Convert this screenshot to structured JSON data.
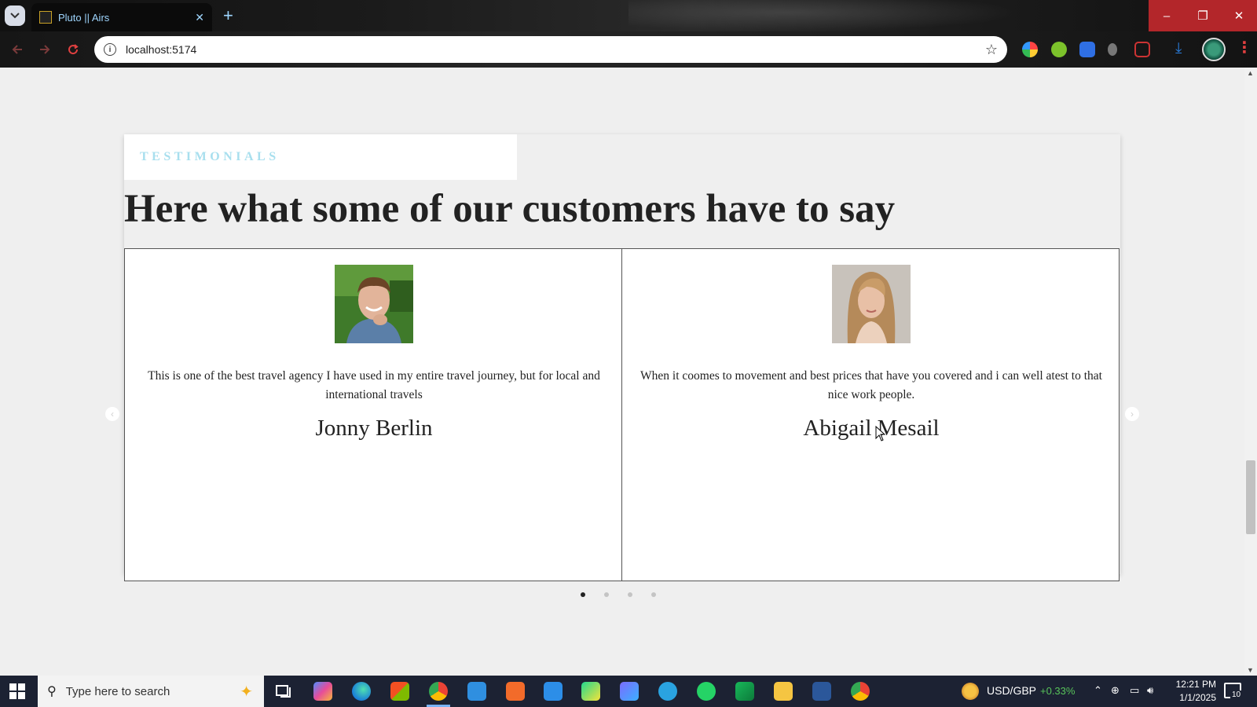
{
  "browser": {
    "tab_title": "Pluto || Airs",
    "tab_close": "✕",
    "new_tab": "+",
    "url": "localhost:5174",
    "window_controls": {
      "minimize": "–",
      "maximize": "❐",
      "close": "✕"
    }
  },
  "page": {
    "section_label": "TESTIMONIALS",
    "heading": "Here what some of our customers have to say",
    "testimonials": [
      {
        "quote": "This is one of the best travel agency I have used in my entire travel journey, but for local and international travels",
        "name": "Jonny Berlin"
      },
      {
        "quote": "When it coomes to movement and best prices that have you covered and i can well atest to that nice work people.",
        "name": "Abigail Mesail"
      }
    ],
    "carousel": {
      "prev": "‹",
      "next": "›",
      "dot_count": 4,
      "active_dot": 1
    }
  },
  "taskbar": {
    "search_placeholder": "Type here to search",
    "ticker_label": "USD/GBP",
    "ticker_value": "+0.33%",
    "time": "12:21 PM",
    "date": "1/1/2025",
    "notification_count": "10"
  },
  "colors": {
    "section_label": "#a8dfee",
    "window_controls_bg": "#b3262a",
    "tab_text": "#9fd6ff",
    "ticker_positive": "#58c35a",
    "taskbar_bg": "#1c2233"
  },
  "icons": [
    "tab-search-icon",
    "favicon-icon",
    "back-icon",
    "forward-icon",
    "reload-icon",
    "info-icon",
    "star-icon",
    "extension-icon",
    "download-icon",
    "menu-icon",
    "windows-start-icon",
    "search-icon",
    "task-view-icon",
    "chrome-icon",
    "edge-icon",
    "vscode-icon",
    "whatsapp-icon",
    "word-icon",
    "explorer-icon"
  ]
}
